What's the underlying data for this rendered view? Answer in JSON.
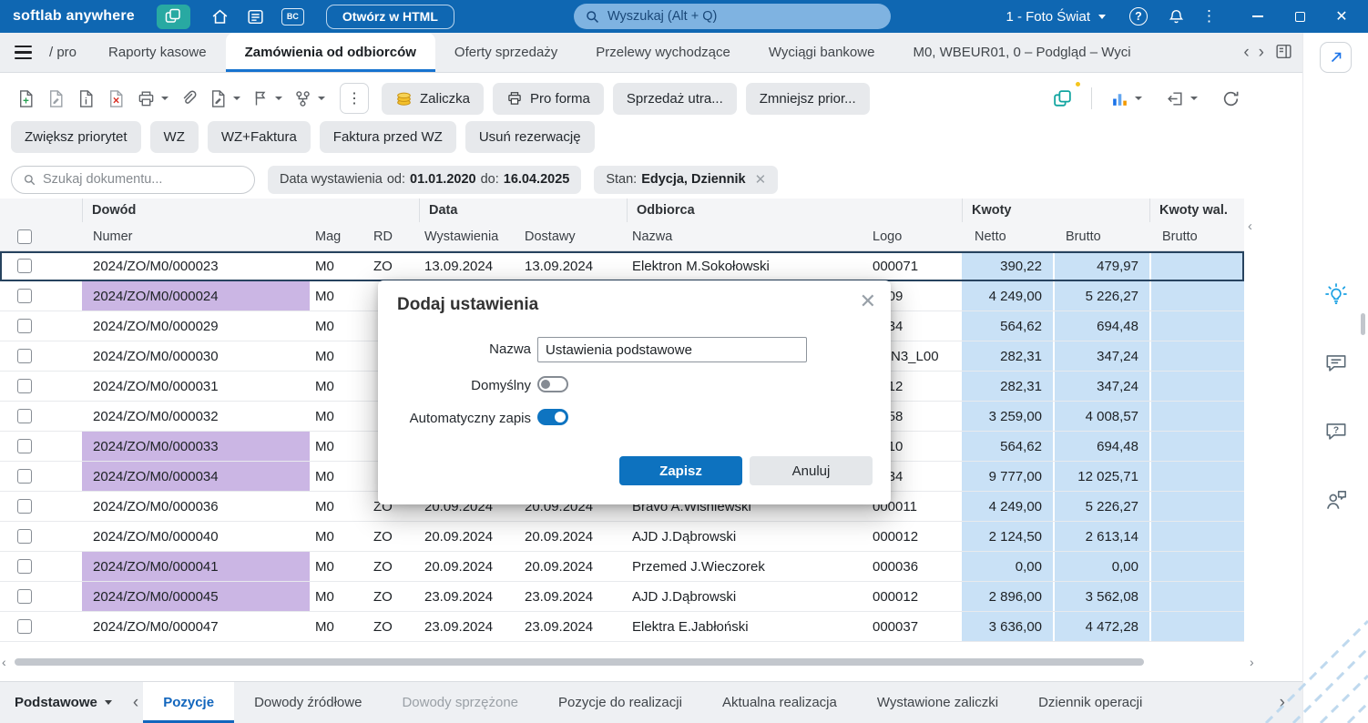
{
  "topbar": {
    "brand": "softlab anywhere",
    "bc_badge": "BC",
    "open_html": "Otwórz w HTML",
    "search_placeholder": "Wyszukaj (Alt + Q)",
    "company": "1 - Foto Świat"
  },
  "tabbar": {
    "overflow_text": "/ pro",
    "tabs": [
      {
        "label": "Raporty kasowe",
        "active": false
      },
      {
        "label": "Zamówienia od odbiorców",
        "active": true
      },
      {
        "label": "Oferty sprzedaży",
        "active": false
      },
      {
        "label": "Przelewy wychodzące",
        "active": false
      },
      {
        "label": "Wyciągi bankowe",
        "active": false
      },
      {
        "label": "M0, WBEUR01, 0 – Podgląd – Wyci",
        "active": false
      }
    ]
  },
  "toolbar": {
    "icon_buttons": [
      "new-document",
      "edit-document",
      "document-info",
      "delete-document",
      "print",
      "attachment",
      "document-options",
      "flag",
      "relations",
      "more-actions",
      "workspaces",
      "analysis",
      "export",
      "refresh"
    ],
    "action_buttons": [
      {
        "label": "Zaliczka",
        "icon": "coins-icon"
      },
      {
        "label": "Pro forma",
        "icon": "printer-icon"
      },
      {
        "label": "Sprzedaż utra...",
        "icon": null
      },
      {
        "label": "Zmniejsz prior...",
        "icon": null
      }
    ],
    "quick_buttons": [
      "Zwiększ priorytet",
      "WZ",
      "WZ+Faktura",
      "Faktura przed WZ",
      "Usuń rezerwację"
    ]
  },
  "filters": {
    "search_placeholder": "Szukaj dokumentu...",
    "date_chip": {
      "label": "Data wystawienia",
      "from_label": "od:",
      "from": "01.01.2020",
      "to_label": "do:",
      "to": "16.04.2025"
    },
    "state_chip": {
      "label": "Stan:",
      "value": "Edycja, Dziennik"
    }
  },
  "table": {
    "group_headers": [
      "Dowód",
      "Data",
      "Odbiorca",
      "Kwoty",
      "Kwoty wal."
    ],
    "columns": [
      "Numer",
      "Mag",
      "RD",
      "Wystawienia",
      "Dostawy",
      "Nazwa",
      "Logo",
      "Netto",
      "Brutto",
      "Brutto"
    ],
    "rows": [
      {
        "numer": "2024/ZO/M0/000023",
        "mag": "M0",
        "rd": "ZO",
        "wystawienia": "13.09.2024",
        "dostawy": "13.09.2024",
        "nazwa": "Elektron M.Sokołowski",
        "logo": "000071",
        "netto": "390,22",
        "brutto": "479,97",
        "brutto_wal": "",
        "selected": true,
        "highlight": false
      },
      {
        "numer": "2024/ZO/M0/000024",
        "mag": "M0",
        "rd": "",
        "wystawienia": "",
        "dostawy": "",
        "nazwa": "",
        "logo": "0009",
        "netto": "4 249,00",
        "brutto": "5 226,27",
        "brutto_wal": "",
        "selected": false,
        "highlight": true
      },
      {
        "numer": "2024/ZO/M0/000029",
        "mag": "M0",
        "rd": "",
        "wystawienia": "",
        "dostawy": "",
        "nazwa": "",
        "logo": "0034",
        "netto": "564,62",
        "brutto": "694,48",
        "brutto_wal": "",
        "selected": false,
        "highlight": false
      },
      {
        "numer": "2024/ZO/M0/000030",
        "mag": "M0",
        "rd": "",
        "wystawienia": "",
        "dostawy": "",
        "nazwa": "",
        "logo": "CZN3_L00",
        "netto": "282,31",
        "brutto": "347,24",
        "brutto_wal": "",
        "selected": false,
        "highlight": false
      },
      {
        "numer": "2024/ZO/M0/000031",
        "mag": "M0",
        "rd": "",
        "wystawienia": "",
        "dostawy": "",
        "nazwa": "",
        "logo": "0012",
        "netto": "282,31",
        "brutto": "347,24",
        "brutto_wal": "",
        "selected": false,
        "highlight": false
      },
      {
        "numer": "2024/ZO/M0/000032",
        "mag": "M0",
        "rd": "",
        "wystawienia": "",
        "dostawy": "",
        "nazwa": "",
        "logo": "0058",
        "netto": "3 259,00",
        "brutto": "4 008,57",
        "brutto_wal": "",
        "selected": false,
        "highlight": false
      },
      {
        "numer": "2024/ZO/M0/000033",
        "mag": "M0",
        "rd": "",
        "wystawienia": "",
        "dostawy": "",
        "nazwa": "",
        "logo": "0010",
        "netto": "564,62",
        "brutto": "694,48",
        "brutto_wal": "",
        "selected": false,
        "highlight": true
      },
      {
        "numer": "2024/ZO/M0/000034",
        "mag": "M0",
        "rd": "",
        "wystawienia": "",
        "dostawy": "",
        "nazwa": "",
        "logo": "0034",
        "netto": "9 777,00",
        "brutto": "12 025,71",
        "brutto_wal": "",
        "selected": false,
        "highlight": true
      },
      {
        "numer": "2024/ZO/M0/000036",
        "mag": "M0",
        "rd": "ZO",
        "wystawienia": "20.09.2024",
        "dostawy": "20.09.2024",
        "nazwa": "Bravo A.Wiśniewski",
        "logo": "000011",
        "netto": "4 249,00",
        "brutto": "5 226,27",
        "brutto_wal": "",
        "selected": false,
        "highlight": false
      },
      {
        "numer": "2024/ZO/M0/000040",
        "mag": "M0",
        "rd": "ZO",
        "wystawienia": "20.09.2024",
        "dostawy": "20.09.2024",
        "nazwa": "AJD J.Dąbrowski",
        "logo": "000012",
        "netto": "2 124,50",
        "brutto": "2 613,14",
        "brutto_wal": "",
        "selected": false,
        "highlight": false
      },
      {
        "numer": "2024/ZO/M0/000041",
        "mag": "M0",
        "rd": "ZO",
        "wystawienia": "20.09.2024",
        "dostawy": "20.09.2024",
        "nazwa": "Przemed J.Wieczorek",
        "logo": "000036",
        "netto": "0,00",
        "brutto": "0,00",
        "brutto_wal": "",
        "selected": false,
        "highlight": true
      },
      {
        "numer": "2024/ZO/M0/000045",
        "mag": "M0",
        "rd": "ZO",
        "wystawienia": "23.09.2024",
        "dostawy": "23.09.2024",
        "nazwa": "AJD J.Dąbrowski",
        "logo": "000012",
        "netto": "2 896,00",
        "brutto": "3 562,08",
        "brutto_wal": "",
        "selected": false,
        "highlight": true
      },
      {
        "numer": "2024/ZO/M0/000047",
        "mag": "M0",
        "rd": "ZO",
        "wystawienia": "23.09.2024",
        "dostawy": "23.09.2024",
        "nazwa": "Elektra E.Jabłoński",
        "logo": "000037",
        "netto": "3 636,00",
        "brutto": "4 472,28",
        "brutto_wal": "",
        "selected": false,
        "highlight": false
      }
    ]
  },
  "dialog": {
    "title": "Dodaj ustawienia",
    "name_label": "Nazwa",
    "name_value": "Ustawienia podstawowe",
    "default_label": "Domyślny",
    "default_on": false,
    "autosave_label": "Automatyczny zapis",
    "autosave_on": true,
    "save_label": "Zapisz",
    "cancel_label": "Anuluj"
  },
  "bottombar": {
    "view_selector": "Podstawowe",
    "tabs": [
      {
        "label": "Pozycje",
        "active": true,
        "muted": false
      },
      {
        "label": "Dowody źródłowe",
        "active": false,
        "muted": false
      },
      {
        "label": "Dowody sprzężone",
        "active": false,
        "muted": true
      },
      {
        "label": "Pozycje do realizacji",
        "active": false,
        "muted": false
      },
      {
        "label": "Aktualna realizacja",
        "active": false,
        "muted": false
      },
      {
        "label": "Wystawione zaliczki",
        "active": false,
        "muted": false
      },
      {
        "label": "Dziennik operacji",
        "active": false,
        "muted": false
      }
    ]
  },
  "sidebar_icons": [
    "ideas-icon",
    "chat-icon",
    "help-chat-icon",
    "feedback-icon"
  ]
}
